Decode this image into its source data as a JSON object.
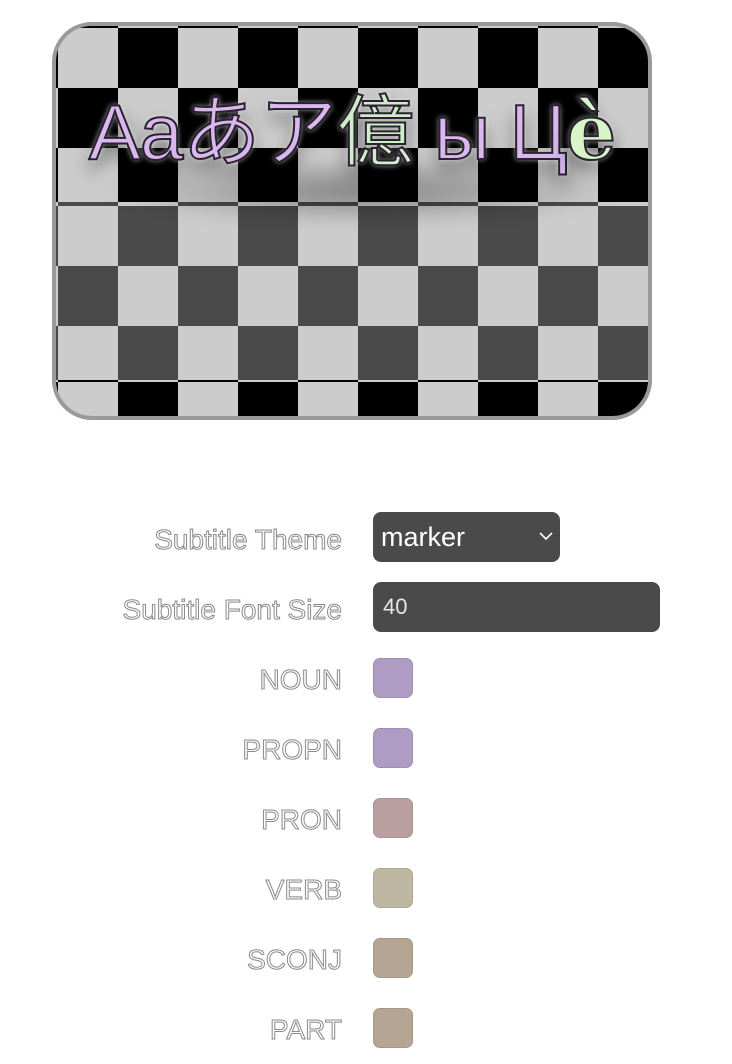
{
  "preview": {
    "subtitle_tokens": [
      {
        "text": "Aa",
        "pos": "noun"
      },
      {
        "text": "あ",
        "pos": "noun"
      },
      {
        "text": "ア",
        "pos": "noun"
      },
      {
        "text": "億",
        "pos": "verb"
      },
      {
        "text": " ы ",
        "pos": "other"
      },
      {
        "text": "Ц",
        "pos": "other"
      },
      {
        "text": "è",
        "pos": "accent"
      }
    ]
  },
  "settings": {
    "theme": {
      "label": "Subtitle Theme",
      "value": "marker"
    },
    "font_size": {
      "label": "Subtitle Font Size",
      "value": "40"
    },
    "pos_colors": [
      {
        "label": "NOUN",
        "color": "#ae9cc4"
      },
      {
        "label": "PROPN",
        "color": "#ae9cc4"
      },
      {
        "label": "PRON",
        "color": "#ba9fa1"
      },
      {
        "label": "VERB",
        "color": "#beb7a2"
      },
      {
        "label": "SCONJ",
        "color": "#b6a592"
      },
      {
        "label": "PART",
        "color": "#b6a592"
      }
    ]
  },
  "icons": {
    "select_arrow": "chevron-down-icon"
  }
}
